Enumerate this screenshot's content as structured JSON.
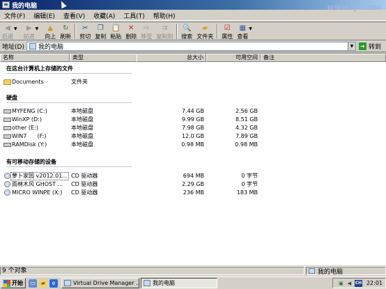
{
  "window": {
    "title": "我的电脑",
    "watermark": "www.ipc.me"
  },
  "menu": [
    "文件(F)",
    "编辑(E)",
    "查看(V)",
    "收藏(A)",
    "工具(T)",
    "帮助(H)"
  ],
  "toolbar": {
    "back": "后退",
    "forward": "前进",
    "up": "向上",
    "refresh": "刷新",
    "cut": "剪切",
    "copy": "复制",
    "paste": "粘贴",
    "delete": "删除",
    "move_to": "移至",
    "copy_to": "复制到",
    "search": "搜索",
    "folders": "文件夹",
    "properties": "属性",
    "views": "查看"
  },
  "address": {
    "label": "地址(D)",
    "value": "我的电脑",
    "go": "转到"
  },
  "columns": {
    "name": "名称",
    "type": "类型",
    "total_size": "总大小",
    "free_space": "可用空间",
    "comments": "备注"
  },
  "groups": {
    "files": {
      "title": "在这台计算机上存储的文件",
      "items": [
        {
          "name": "Documents",
          "type": "文件夹",
          "total": "",
          "free": ""
        }
      ]
    },
    "hdd": {
      "title": "硬盘",
      "items": [
        {
          "name": "MYFENG (C:)",
          "type": "本地磁盘",
          "total": "7.44 GB",
          "free": "2.56 GB"
        },
        {
          "name": "WinXP (D:)",
          "type": "本地磁盘",
          "total": "9.99 GB",
          "free": "8.51 GB"
        },
        {
          "name": "other (E:)",
          "type": "本地磁盘",
          "total": "7.98 GB",
          "free": "4.32 GB"
        },
        {
          "name": "WIN7      (F:)",
          "type": "本地磁盘",
          "total": "12.0 GB",
          "free": "7.89 GB"
        },
        {
          "name": "RAMDisk (Y:)",
          "type": "本地磁盘",
          "total": "0.98 MB",
          "free": "0.98 MB"
        }
      ]
    },
    "removable": {
      "title": "有可移动存储的设备",
      "items": [
        {
          "name": "萝卜家园 v2012.01...",
          "type": "CD 驱动器",
          "total": "694 MB",
          "free": "0 字节"
        },
        {
          "name": "雨林木风 GHOST ...",
          "type": "CD 驱动器",
          "total": "2.29 GB",
          "free": "0 字节"
        },
        {
          "name": "MICRO WINPE (X:)",
          "type": "CD 驱动器",
          "total": "236 MB",
          "free": "183 MB"
        }
      ]
    }
  },
  "status": {
    "count": "9 个对象",
    "location": "我的电脑"
  },
  "taskbar": {
    "start": "开始",
    "tasks": [
      "Virtual Drive Manager ...",
      "我的电脑"
    ],
    "clock": "22:01",
    "ime": "CH"
  }
}
